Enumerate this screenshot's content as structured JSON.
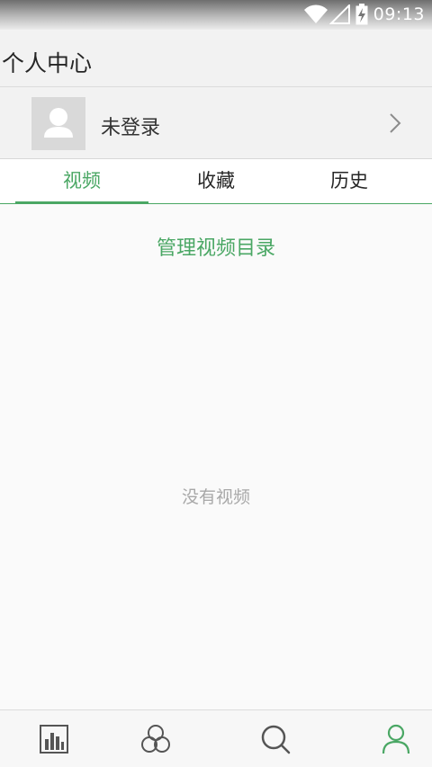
{
  "status_bar": {
    "time": "09:13",
    "icons": [
      "wifi-icon",
      "signal-icon",
      "battery-charging-icon"
    ]
  },
  "header": {
    "title": "个人中心"
  },
  "user": {
    "login_label": "未登录",
    "avatar_icon": "user-placeholder-icon",
    "chevron_icon": "chevron-right-icon"
  },
  "tabs": [
    {
      "label": "视频",
      "active": true
    },
    {
      "label": "收藏",
      "active": false
    },
    {
      "label": "历史",
      "active": false
    }
  ],
  "content": {
    "manage_link": "管理视频目录",
    "empty_text": "没有视频"
  },
  "bottom_nav": {
    "items": [
      {
        "icon": "chart-icon",
        "active": false
      },
      {
        "icon": "circles-icon",
        "active": false
      },
      {
        "icon": "search-icon",
        "active": false
      },
      {
        "icon": "profile-icon",
        "active": true
      }
    ]
  },
  "colors": {
    "accent": "#4aa764",
    "text_primary": "#262626",
    "text_muted": "#a8a8a8",
    "icon_gray": "#555555"
  }
}
